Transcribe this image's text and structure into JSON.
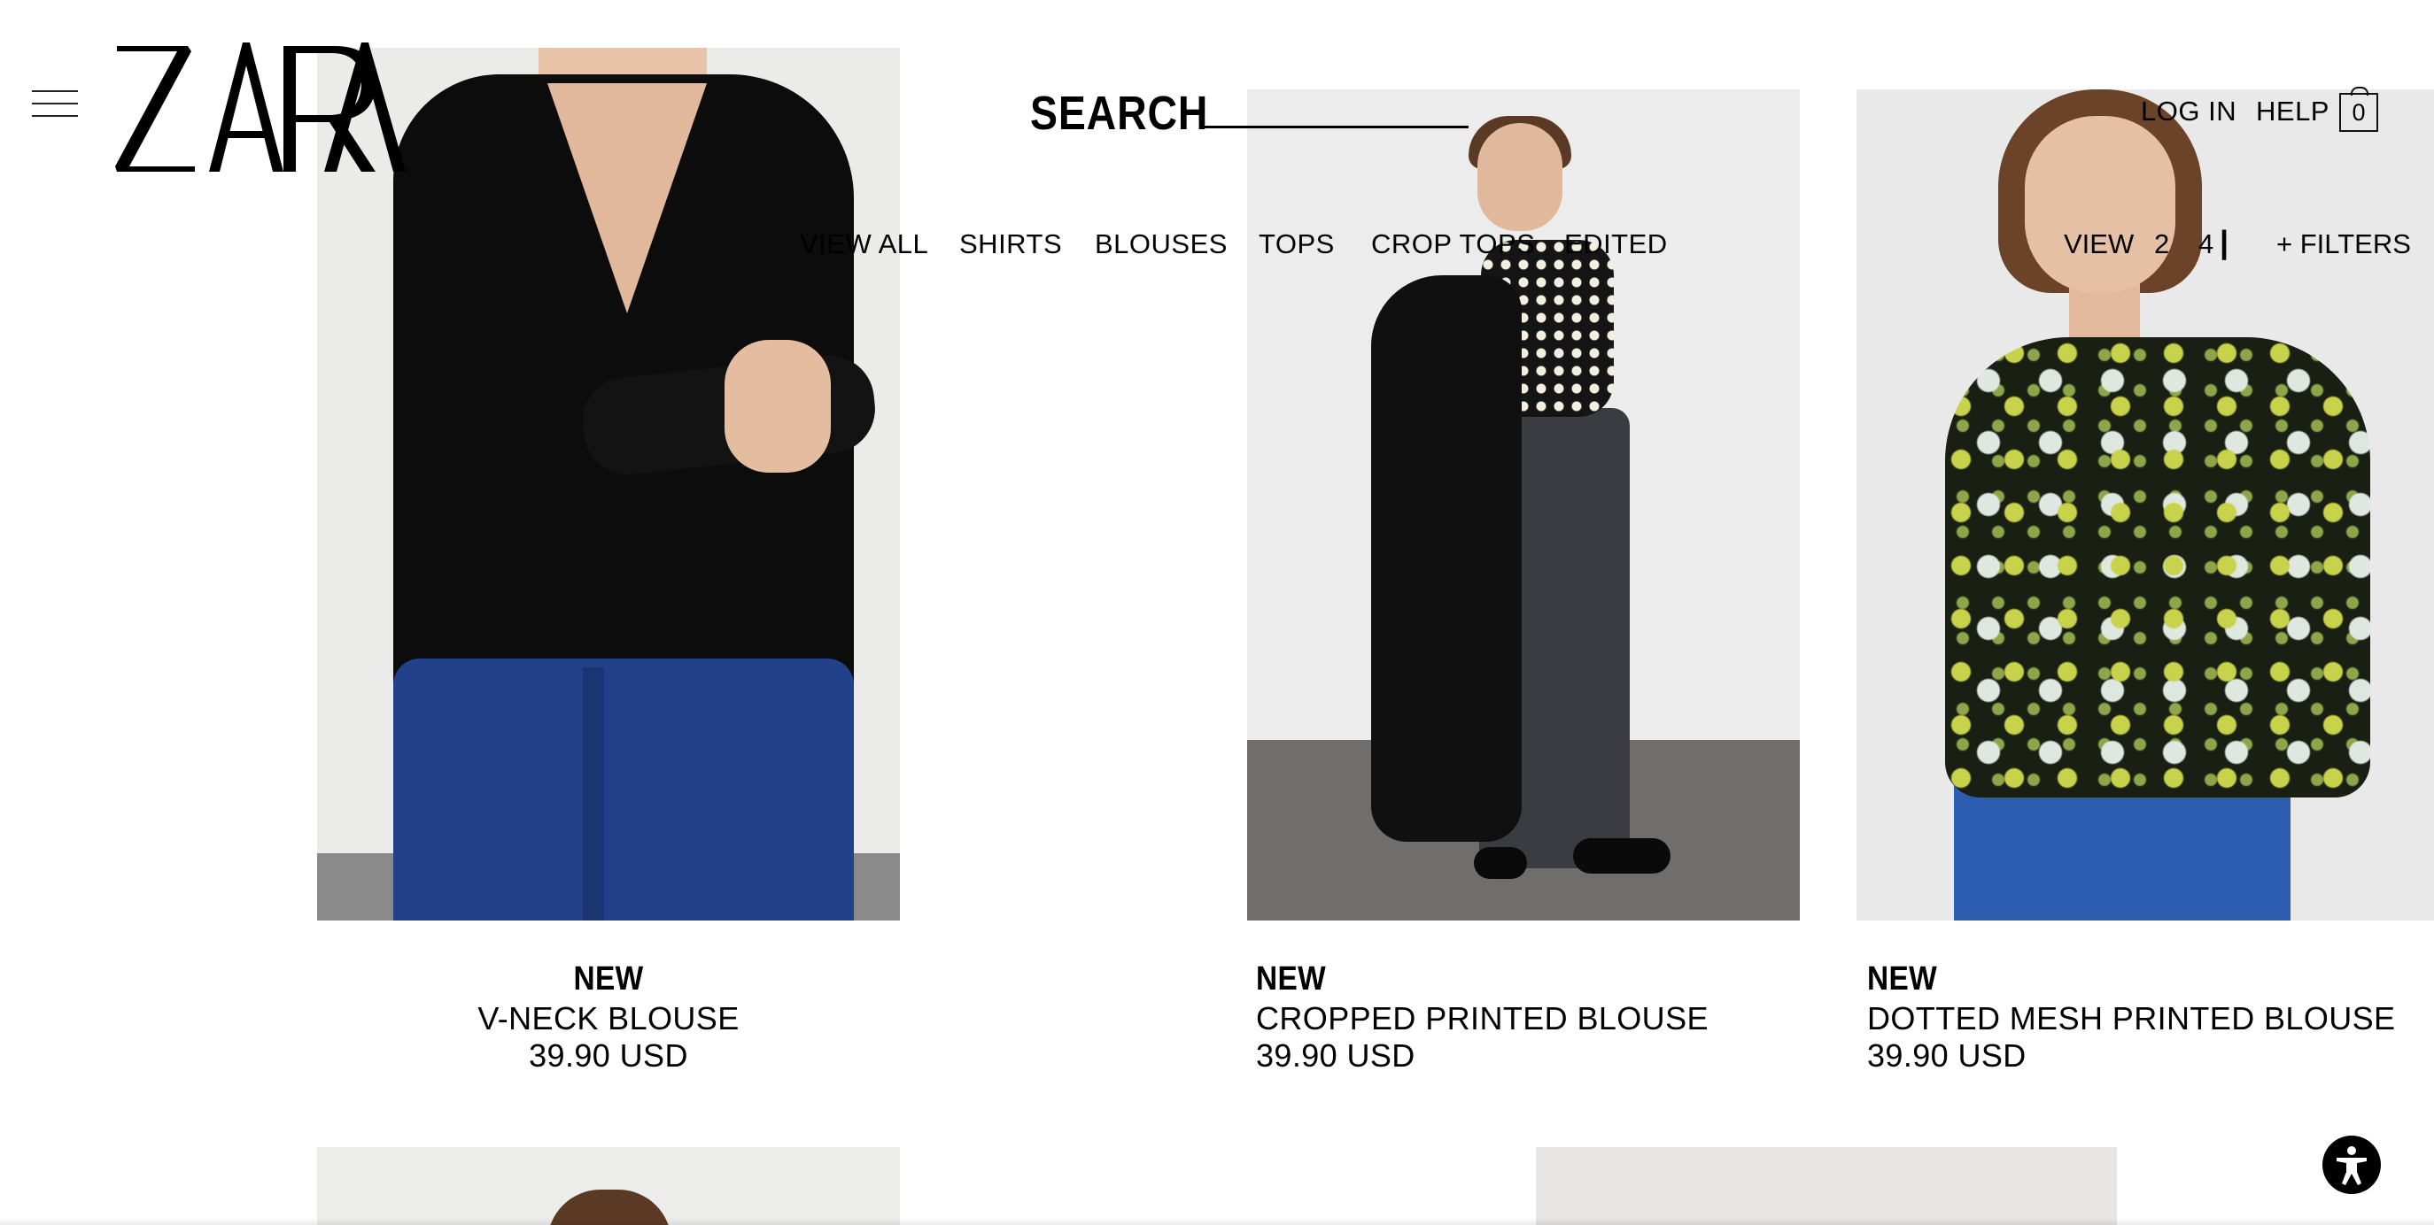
{
  "header": {
    "logo_text": "ZARA",
    "search_label": "SEARCH",
    "search_value": "",
    "login_label": "LOG IN",
    "help_label": "HELP",
    "cart_count": "0"
  },
  "categories": {
    "view_all": "VIEW ALL",
    "shirts": "SHIRTS",
    "blouses": "BLOUSES",
    "tops": "TOPS",
    "crop_tops": "CROP TOPS",
    "edited": "EDITED"
  },
  "view_options": {
    "label": "VIEW",
    "option_2": "2",
    "option_4": "4",
    "separator": "|",
    "filters": "+ FILTERS"
  },
  "products": [
    {
      "badge": "NEW",
      "name": "V-NECK BLOUSE",
      "price": "39.90 USD"
    },
    {
      "badge": "NEW",
      "name": "CROPPED PRINTED BLOUSE",
      "price": "39.90 USD"
    },
    {
      "badge": "NEW",
      "name": "DOTTED MESH PRINTED BLOUSE",
      "price": "39.90 USD"
    }
  ],
  "accessibility": {
    "icon": "accessibility-icon"
  }
}
